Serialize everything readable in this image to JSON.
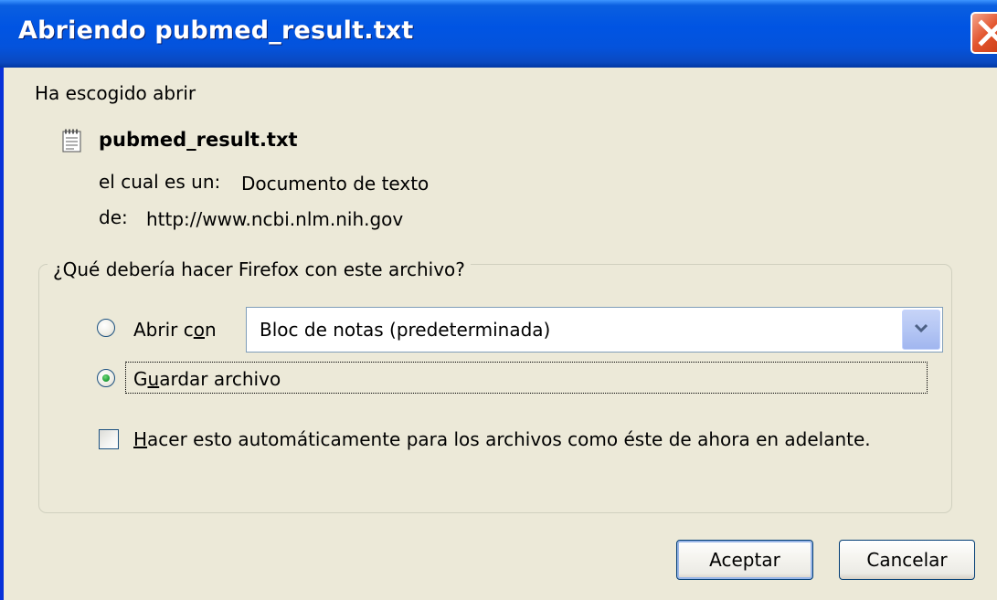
{
  "window": {
    "title": "Abriendo pubmed_result.txt"
  },
  "intro": "Ha escogido abrir",
  "file": {
    "name": "pubmed_result.txt",
    "type_label": "el cual es un:",
    "type_value": "Documento de texto",
    "from_label": "de:",
    "from_value": "http://www.ncbi.nlm.nih.gov"
  },
  "question": "¿Qué debería hacer Firefox con este archivo?",
  "options": {
    "open_with": {
      "label_pre": "Abrir c",
      "label_mnemonic": "o",
      "label_post": "n",
      "selected": false
    },
    "application": {
      "selected_value": "Bloc de notas (predeterminada)"
    },
    "save_file": {
      "label_pre": "G",
      "label_mnemonic": "u",
      "label_post": "ardar archivo",
      "selected": true
    },
    "auto": {
      "label_mnemonic": "H",
      "label_post": "acer esto automáticamente para los archivos como éste de ahora en adelante.",
      "checked": false
    }
  },
  "buttons": {
    "ok": "Aceptar",
    "cancel": "Cancelar"
  },
  "colors": {
    "titlebar": "#0054e3",
    "dialog_bg": "#ece9d8",
    "radio_dot": "#24a33a",
    "close_button": "#e2532c"
  },
  "icons": {
    "file": "text-file-icon",
    "close": "close-icon",
    "dropdown": "chevron-down-icon"
  }
}
